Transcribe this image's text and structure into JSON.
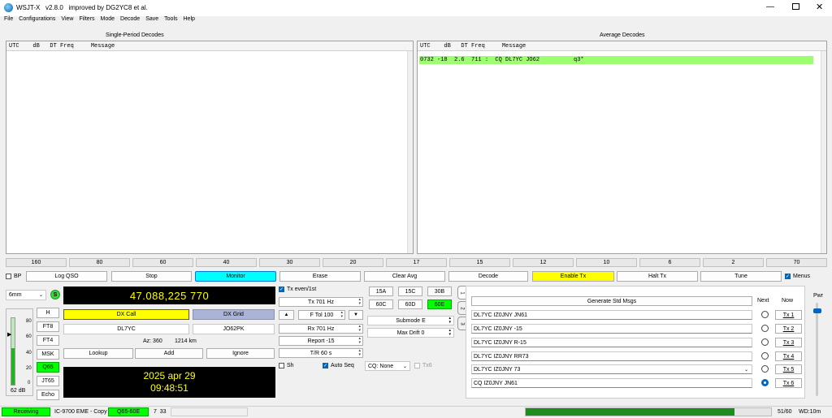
{
  "titlebar": {
    "title": "WSJT-X   v2.8.0   improved by DG2YC8 et al."
  },
  "menu": [
    "File",
    "Configurations",
    "View",
    "Filters",
    "Mode",
    "Decode",
    "Save",
    "Tools",
    "Help"
  ],
  "left_panel": {
    "title": "Single-Period Decodes",
    "header": "UTC    dB   DT Freq     Message"
  },
  "right_panel": {
    "title": "Average Decodes",
    "header": "UTC    dB   DT Freq     Message",
    "lines": [
      "0732 -18  2.6  711 :  CQ DL7YC JO62          q3*"
    ]
  },
  "bands": [
    "160",
    "80",
    "60",
    "40",
    "30",
    "20",
    "17",
    "15",
    "12",
    "10",
    "6",
    "2",
    "70"
  ],
  "controls": {
    "bp": "BP",
    "log_qso": "Log QSO",
    "stop": "Stop",
    "monitor": "Monitor",
    "erase": "Erase",
    "clear_avg": "Clear Avg",
    "decode": "Decode",
    "enable_tx": "Enable Tx",
    "halt_tx": "Halt Tx",
    "tune": "Tune",
    "menus": "Menus"
  },
  "band_select": "6mm",
  "s_badge": "S",
  "frequency": "47.088,225 770",
  "dx": {
    "call_label": "DX Call",
    "grid_label": "DX Grid",
    "call": "DL7YC",
    "grid": "JO62PK",
    "az": "Az: 360",
    "dist": "1214 km",
    "lookup": "Lookup",
    "add": "Add",
    "ignore": "Ignore"
  },
  "clock": {
    "date": "2025 apr 29",
    "time": "09:48:51"
  },
  "meter": {
    "ticks": [
      "80",
      "60",
      "40",
      "20",
      "0"
    ],
    "reading": "62 dB",
    "level": 0.55
  },
  "modes": [
    "H",
    "FT8",
    "FT4",
    "MSK",
    "Q65",
    "JT65",
    "Echo"
  ],
  "tx_settings": {
    "tx_even": "Tx even/1st",
    "tx_freq": "Tx  701  Hz",
    "up": "▲",
    "ftol": "F Tol  100",
    "down": "▼",
    "rx_freq": "Rx  701  Hz",
    "report": "Report  -15",
    "tr": "T/R  60  s",
    "sh": "Sh",
    "auto_seq": "Auto Seq",
    "cq": "CQ: None",
    "tx6": "Tx6"
  },
  "submodes": [
    "15A",
    "15C",
    "30B",
    "60C",
    "60D",
    "60E"
  ],
  "submode_select": "Submode E",
  "max_drift": "Max Drift  0",
  "side_tabs": [
    "1",
    "2",
    "3"
  ],
  "messages": {
    "generate": "Generate Std Msgs",
    "next": "Next",
    "now": "Now",
    "list": [
      "DL7YC IZ0JNY JN61",
      "DL7YC IZ0JNY -15",
      "DL7YC IZ0JNY R-15",
      "DL7YC IZ0JNY RR73",
      "DL7YC IZ0JNY 73",
      "CQ IZ0JNY JN61"
    ],
    "tx": [
      "Tx 1",
      "Tx 2",
      "Tx 3",
      "Tx 4",
      "Tx 5",
      "Tx 6"
    ]
  },
  "pwr_label": "Pwr",
  "pwr_level": 0.05,
  "status": {
    "receiving": "Receiving",
    "rig": "IC-9700 EME - Copy",
    "mode": "Q65-60E",
    "tr": "7  33",
    "progress": "51/60",
    "progress_value": 0.85,
    "wd": "WD:10m"
  },
  "colors": {
    "monitor": "#00ffff",
    "enable_tx": "#ffff00",
    "q65": "#00ff00",
    "decode_line": "#9cff6f",
    "status_green": "#00ff00"
  }
}
